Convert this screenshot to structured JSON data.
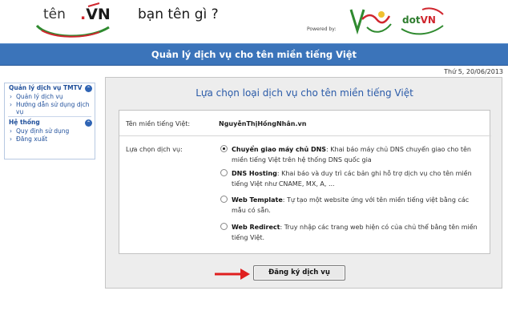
{
  "header": {
    "logo_text_ten": "tên",
    "logo_text_dot": ".",
    "logo_text_vn": "VN",
    "slogan": "bạn tên gì ?",
    "powered_by": "Powered by:",
    "partner_logo_vnnic": "Vnnic",
    "partner_logo_dotvn_dot": "dot",
    "partner_logo_dotvn_vn": "VN"
  },
  "titlebar": {
    "title": "Quản lý dịch vụ cho tên miền tiếng Việt"
  },
  "date": "Thứ 5, 20/06/2013",
  "sidebar": {
    "section1_title": "Quản lý dịch vụ TMTV",
    "section1_items": [
      "Quản lý dịch vụ",
      "Hướng dẫn sử dụng dịch vụ"
    ],
    "section2_title": "Hệ thống",
    "section2_items": [
      "Quy định sử dụng",
      "Đăng xuất"
    ]
  },
  "main": {
    "title": "Lựa chọn loại dịch vụ cho tên miền tiếng Việt",
    "domain_label": "Tên miền tiếng Việt:",
    "domain_value": "NguyễnThịHồngNhân.vn",
    "service_label": "Lựa chọn dịch vụ:",
    "options": [
      {
        "name": "Chuyển giao máy chủ DNS",
        "desc": ": Khai báo máy chủ DNS chuyển giao cho tên miền tiếng Việt trên hệ thống DNS quốc gia",
        "selected": true
      },
      {
        "name": "DNS Hosting",
        "desc": ": Khai báo và duy trì các bản ghi hỗ trợ dịch vụ cho tên miền tiếng Việt như CNAME, MX, A, ...",
        "selected": false
      },
      {
        "name": "Web Template",
        "desc": ": Tự tạo một website ứng với tên miền tiếng việt bằng các mẫu có sẵn.",
        "selected": false
      },
      {
        "name": "Web Redirect",
        "desc": ": Truy nhập các trang web hiện có của chủ thể bằng tên miền tiếng Việt.",
        "selected": false
      }
    ],
    "submit_label": "Đăng ký dịch vụ"
  },
  "colors": {
    "titlebar_bg": "#3b74ba",
    "link_blue": "#1f4f9b",
    "panel_bg": "#ededed",
    "arrow_red": "#e02020"
  }
}
